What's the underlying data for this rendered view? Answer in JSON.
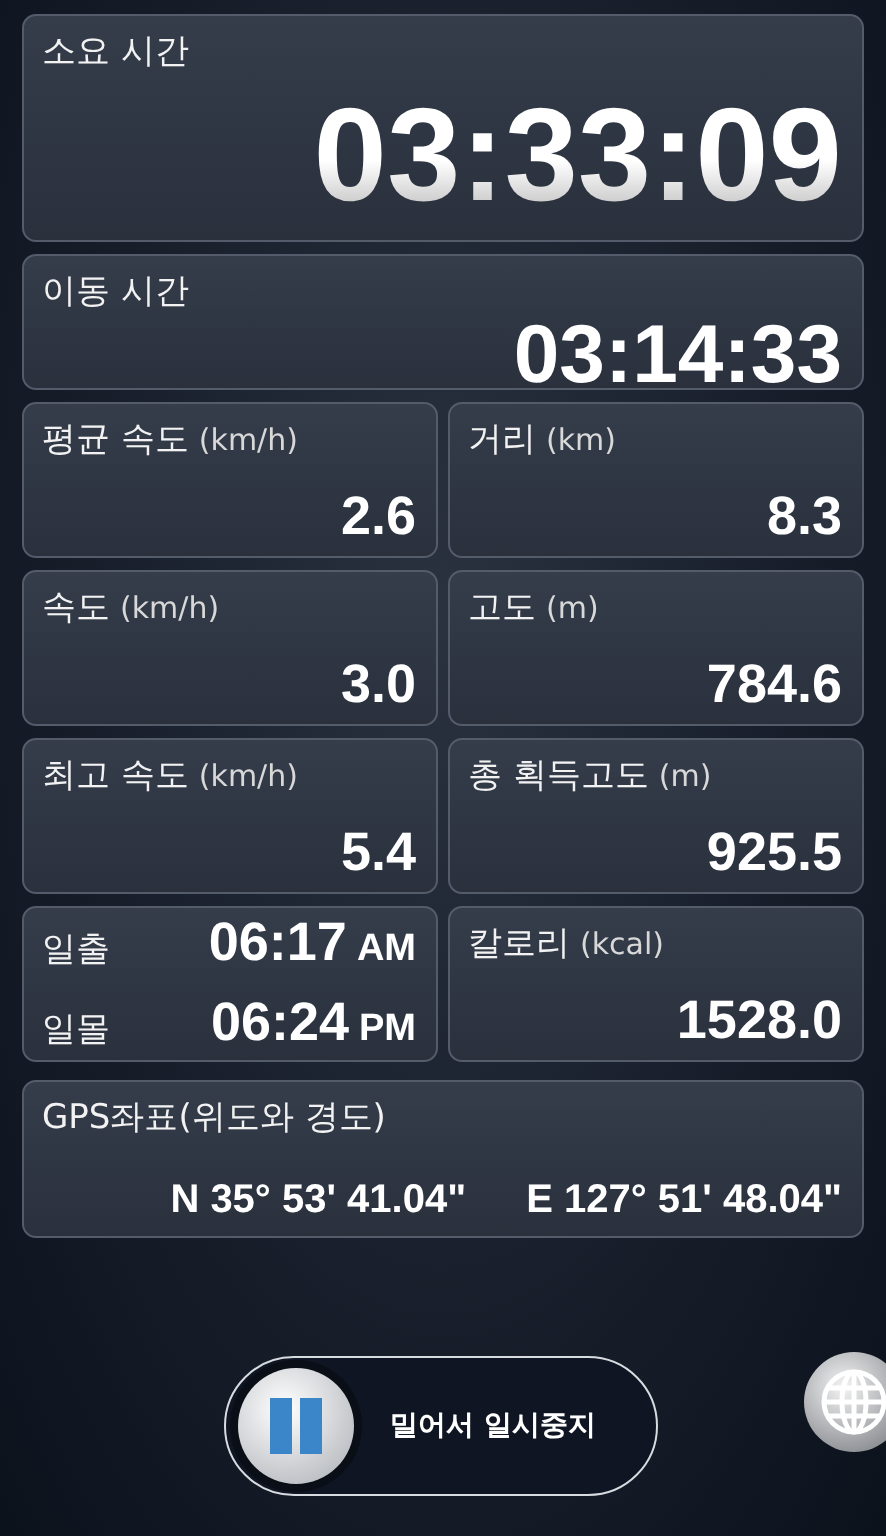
{
  "elapsed": {
    "label": "소요 시간",
    "value": "03:33:09"
  },
  "moving": {
    "label": "이동 시간",
    "value": "03:14:33"
  },
  "stats": [
    {
      "kind": "stat",
      "label": "평균 속도",
      "unit": "(km/h)",
      "value": "2.6"
    },
    {
      "kind": "stat",
      "label": "거리",
      "unit": "(km)",
      "value": "8.3"
    },
    {
      "kind": "stat",
      "label": "속도",
      "unit": "(km/h)",
      "value": "3.0"
    },
    {
      "kind": "stat",
      "label": "고도",
      "unit": "(m)",
      "value": "784.6"
    },
    {
      "kind": "stat",
      "label": "최고 속도",
      "unit": "(km/h)",
      "value": "5.4"
    },
    {
      "kind": "stat",
      "label": "총 획득고도",
      "unit": "(m)",
      "value": "925.5"
    },
    {
      "kind": "sun",
      "rows": [
        {
          "label": "일출",
          "time": "06:17",
          "period": "AM"
        },
        {
          "label": "일몰",
          "time": "06:24",
          "period": "PM"
        }
      ]
    },
    {
      "kind": "stat",
      "label": "칼로리",
      "unit": "(kcal)",
      "value": "1528.0"
    }
  ],
  "gps": {
    "label": "GPS좌표(위도와 경도)",
    "latitude": "N 35° 53' 41.04\"",
    "longitude": "E 127° 51' 48.04\""
  },
  "slider": {
    "label": "밀어서 일시중지",
    "level": 0
  }
}
